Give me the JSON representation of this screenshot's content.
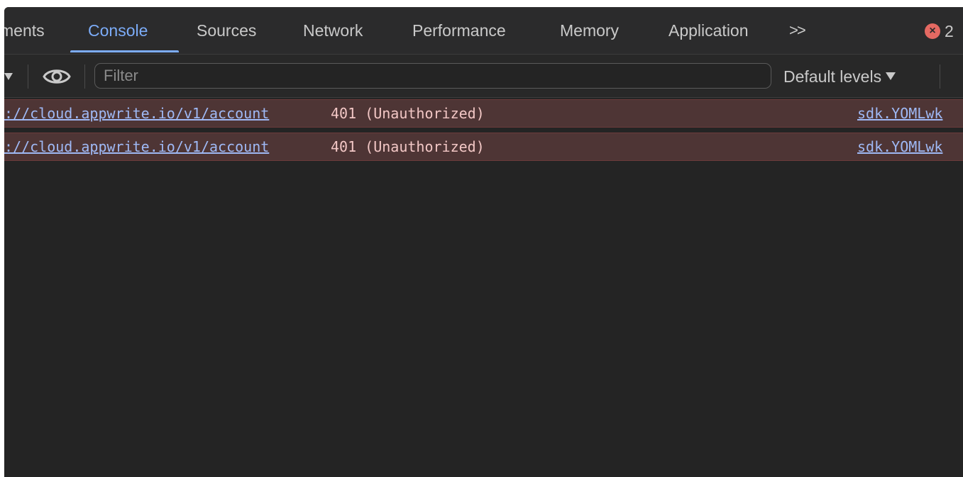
{
  "tabs": [
    {
      "label": "ments",
      "active": false
    },
    {
      "label": "Console",
      "active": true
    },
    {
      "label": "Sources",
      "active": false
    },
    {
      "label": "Network",
      "active": false
    },
    {
      "label": "Performance",
      "active": false
    },
    {
      "label": "Memory",
      "active": false
    },
    {
      "label": "Application",
      "active": false
    }
  ],
  "tab_overflow_label": ">>",
  "error_counter": {
    "count": "2",
    "icon": "error-x-icon",
    "color": "#e46962"
  },
  "toolbar": {
    "filter_placeholder": "Filter",
    "filter_value": "",
    "levels_label": "Default levels"
  },
  "messages": [
    {
      "url": "://cloud.appwrite.io/v1/account",
      "text": "401 (Unauthorized)",
      "source": "sdk.YOMLwk"
    },
    {
      "url": "://cloud.appwrite.io/v1/account",
      "text": "401 (Unauthorized)",
      "source": "sdk.YOMLwk"
    }
  ],
  "colors": {
    "accent": "#7cacf8",
    "error_row_bg": "#4e3535",
    "panel_bg": "#242424"
  }
}
